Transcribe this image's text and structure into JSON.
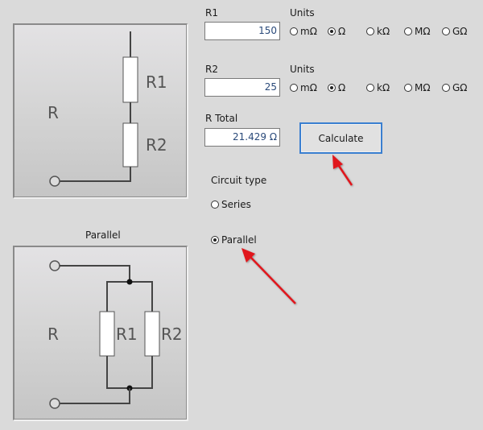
{
  "series_diagram": {
    "r_label": "R",
    "r1_label": "R1",
    "r2_label": "R2"
  },
  "parallel_diagram": {
    "title": "Parallel",
    "r_label": "R",
    "r1_label": "R1",
    "r2_label": "R2"
  },
  "r1": {
    "label": "R1",
    "value": "150",
    "units_label": "Units",
    "units": [
      {
        "label": "mΩ",
        "checked": false
      },
      {
        "label": "Ω",
        "checked": true
      },
      {
        "label": "kΩ",
        "checked": false
      },
      {
        "label": "MΩ",
        "checked": false
      },
      {
        "label": "GΩ",
        "checked": false
      }
    ]
  },
  "r2": {
    "label": "R2",
    "value": "25",
    "units_label": "Units",
    "units": [
      {
        "label": "mΩ",
        "checked": false
      },
      {
        "label": "Ω",
        "checked": true
      },
      {
        "label": "kΩ",
        "checked": false
      },
      {
        "label": "MΩ",
        "checked": false
      },
      {
        "label": "GΩ",
        "checked": false
      }
    ]
  },
  "r_total": {
    "label": "R Total",
    "value": "21.429 Ω"
  },
  "calculate_button": {
    "label": "Calculate"
  },
  "circuit_type": {
    "label": "Circuit type",
    "options": [
      {
        "label": "Series",
        "checked": false
      },
      {
        "label": "Parallel",
        "checked": true
      }
    ]
  },
  "annotation_color": "#e0141c"
}
